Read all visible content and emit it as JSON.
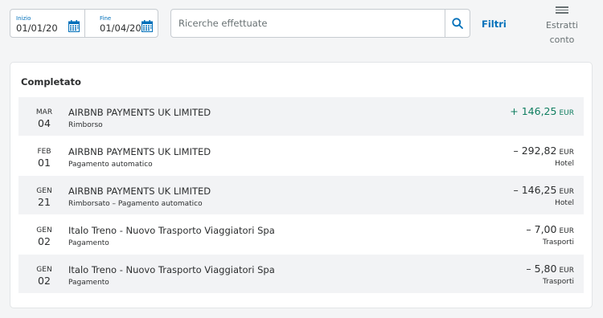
{
  "filters": {
    "start_label": "Inizio",
    "start_value": "01/01/20",
    "end_label": "Fine",
    "end_value": "01/04/20",
    "calendar_icon": "calendar-icon",
    "search_placeholder": "Ricerche effettuate",
    "search_icon": "search-icon",
    "filters_label": "Filtri",
    "statements_label": "Estratti conto",
    "statements_icon": "hamburger-menu-icon",
    "accent_color": "#0070ba"
  },
  "section": {
    "title": "Completato"
  },
  "transactions": [
    {
      "month": "MAR",
      "day": "04",
      "name": "AIRBNB PAYMENTS UK LIMITED",
      "subtitle": "Rimborso",
      "amount": "+ 146,25",
      "currency": "EUR",
      "category": ""
    },
    {
      "month": "FEB",
      "day": "01",
      "name": "AIRBNB PAYMENTS UK LIMITED",
      "subtitle": "Pagamento automatico",
      "amount": "– 292,82",
      "currency": "EUR",
      "category": "Hotel"
    },
    {
      "month": "GEN",
      "day": "21",
      "name": "AIRBNB PAYMENTS UK LIMITED",
      "subtitle": "Rimborsato – Pagamento automatico",
      "amount": "– 146,25",
      "currency": "EUR",
      "category": "Hotel"
    },
    {
      "month": "GEN",
      "day": "02",
      "name": "Italo Treno - Nuovo Trasporto Viaggiatori Spa",
      "subtitle": "Pagamento",
      "amount": "– 7,00",
      "currency": "EUR",
      "category": "Trasporti"
    },
    {
      "month": "GEN",
      "day": "02",
      "name": "Italo Treno - Nuovo Trasporto Viaggiatori Spa",
      "subtitle": "Pagamento",
      "amount": "– 5,80",
      "currency": "EUR",
      "category": "Trasporti"
    }
  ],
  "colors": {
    "positive_amount": "#0f7d5f",
    "row_shade": "#f2f3f5"
  }
}
